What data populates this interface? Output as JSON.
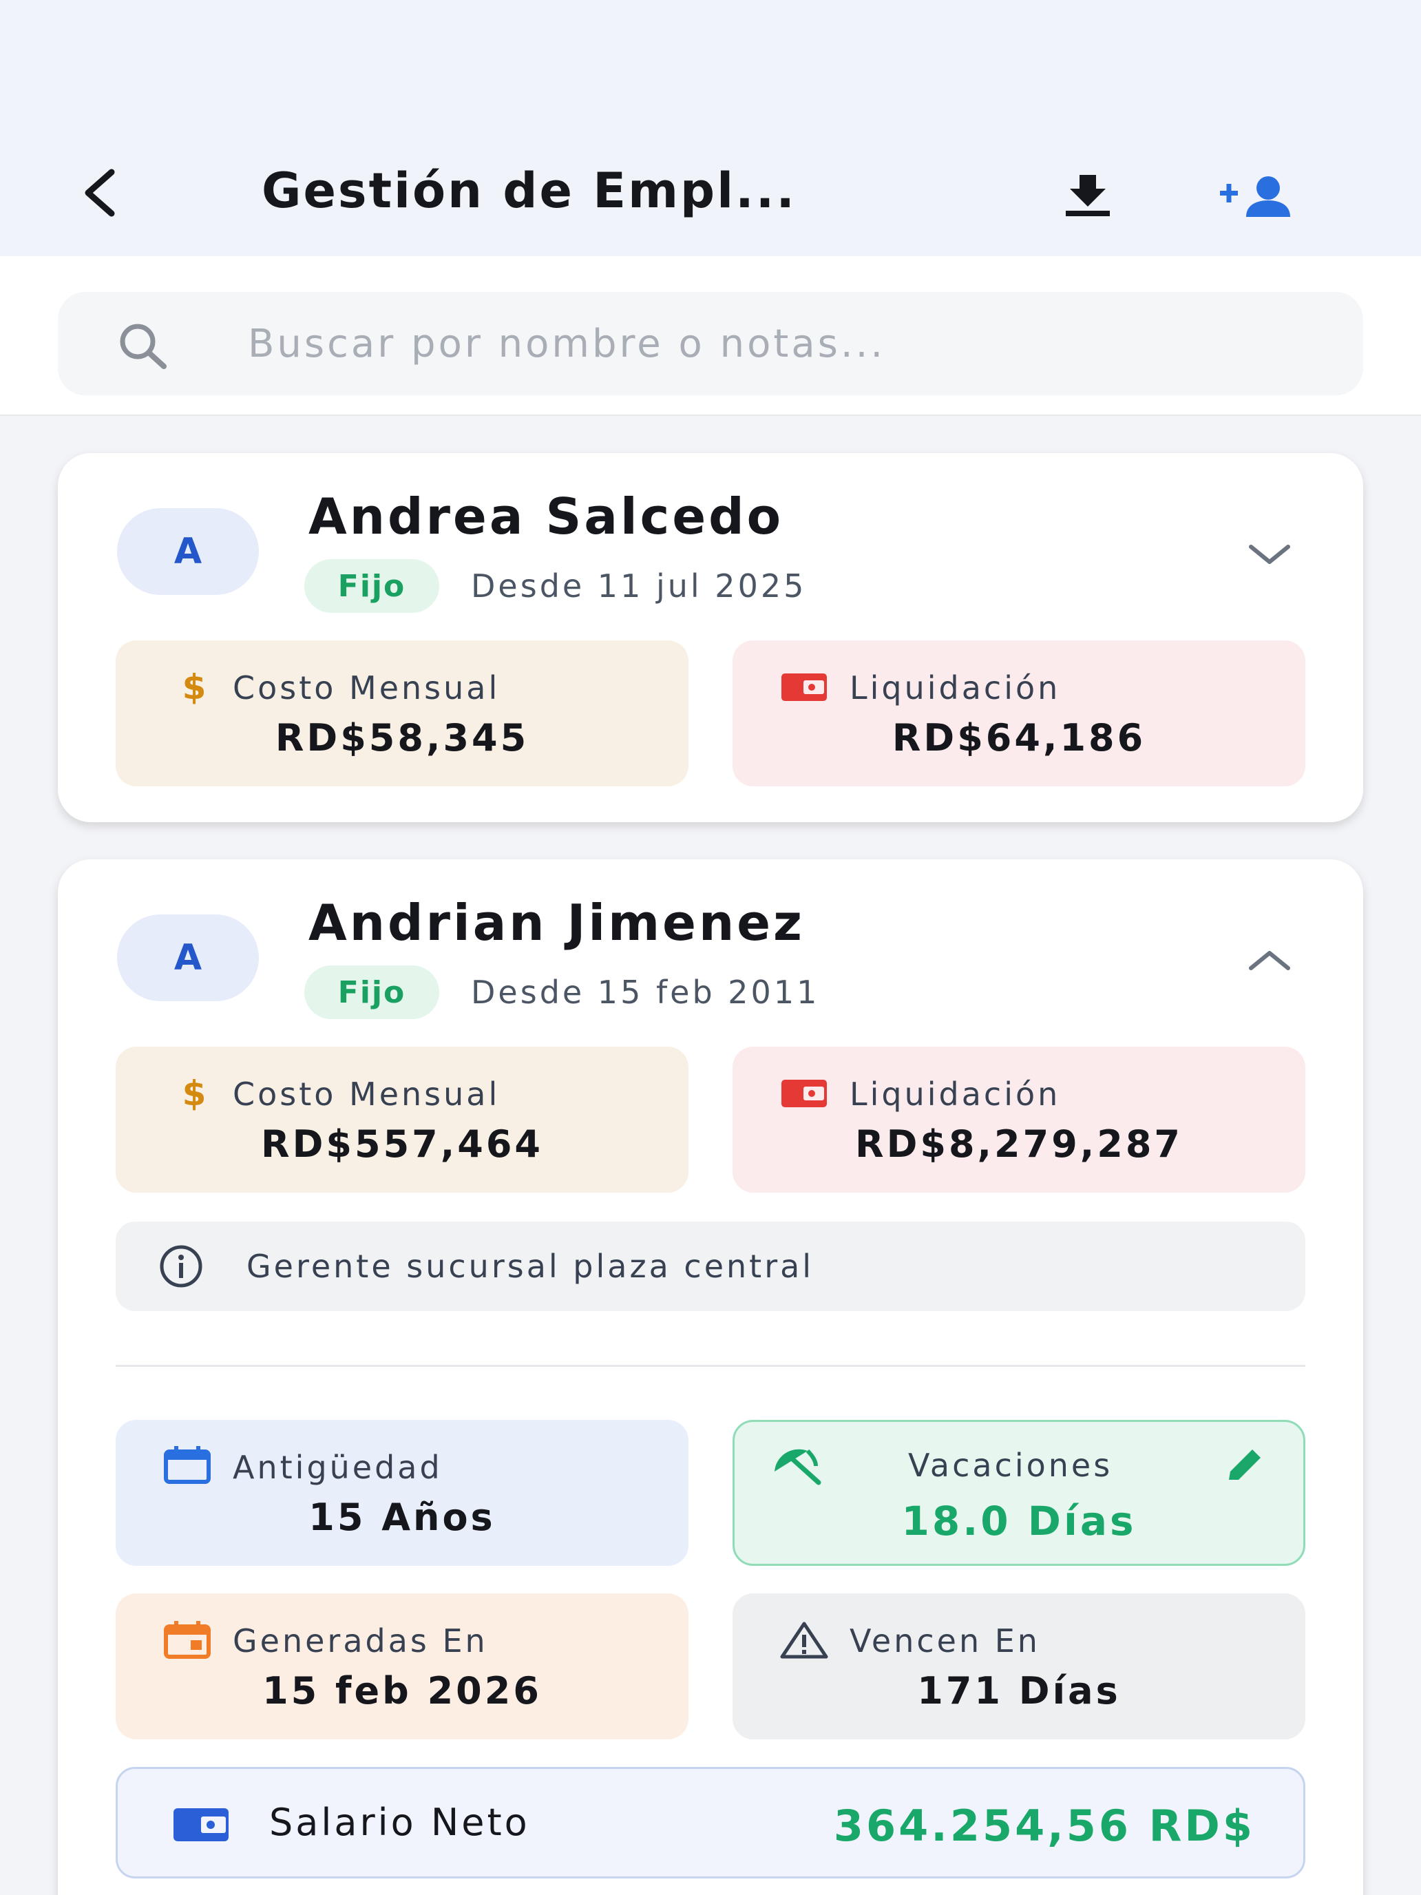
{
  "header": {
    "title": "Gestión de Empl...",
    "back_icon": "chevron-left-icon",
    "download_icon": "download-icon",
    "add_user_icon": "person-add-icon"
  },
  "search": {
    "placeholder": "Buscar por nombre o notas...",
    "value": "",
    "icon": "search-icon"
  },
  "colors": {
    "accent_blue": "#2457c9",
    "badge_green": "#1aa060",
    "cost_bg": "#f8f0e4",
    "liquidation_bg": "#fcebec",
    "vacation_bg": "#e7f6ef",
    "salary_green": "#1aa86a"
  },
  "employees": [
    {
      "initial": "A",
      "name": "Andrea Salcedo",
      "type": "Fijo",
      "since": "Desde 11 jul 2025",
      "expanded": false,
      "expand_icon": "chevron-down-icon",
      "cost_label": "Costo Mensual",
      "cost_value": "RD$58,345",
      "cost_icon": "dollar-icon",
      "liquidation_label": "Liquidación",
      "liquidation_value": "RD$64,186",
      "liquidation_icon": "wallet-icon"
    },
    {
      "initial": "A",
      "name": "Andrian Jimenez",
      "type": "Fijo",
      "since": "Desde 15 feb 2011",
      "expanded": true,
      "expand_icon": "chevron-up-icon",
      "cost_label": "Costo Mensual",
      "cost_value": "RD$557,464",
      "cost_icon": "dollar-icon",
      "liquidation_label": "Liquidación",
      "liquidation_value": "RD$8,279,287",
      "liquidation_icon": "wallet-icon",
      "note": "Gerente sucursal plaza central",
      "note_icon": "info-icon",
      "seniority_label": "Antigüedad",
      "seniority_value": "15 Años",
      "seniority_icon": "calendar-icon",
      "vacation_label": "Vacaciones",
      "vacation_value": "18.0 Días",
      "vacation_icon": "beach-umbrella-icon",
      "vacation_edit_icon": "pencil-icon",
      "generated_label": "Generadas En",
      "generated_value": "15 feb 2026",
      "generated_icon": "calendar-event-icon",
      "expires_label": "Vencen En",
      "expires_value": "171 Días",
      "expires_icon": "warning-icon",
      "salary_label": "Salario Neto",
      "salary_value": "364.254,56 RD$",
      "salary_icon": "wallet-icon"
    }
  ]
}
